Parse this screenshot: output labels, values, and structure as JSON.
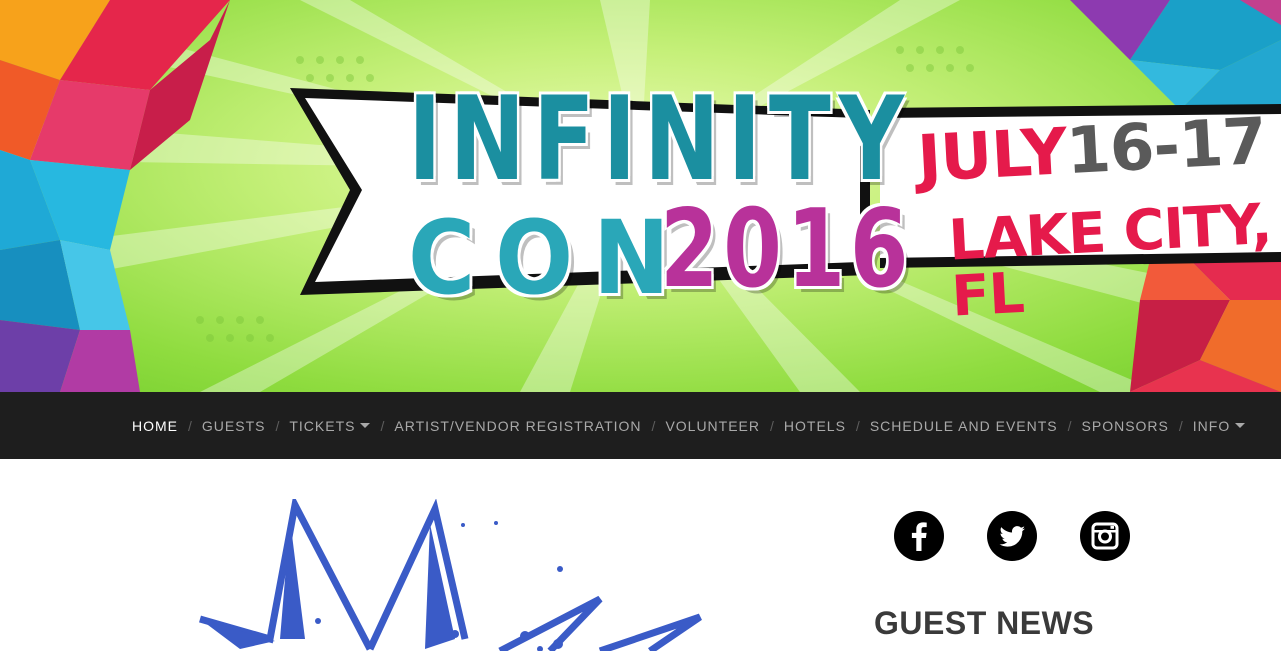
{
  "banner": {
    "title_line1": "INFINITY",
    "title_con": "CON",
    "title_year": "2016",
    "date_month": "JULY",
    "date_days": "16-17",
    "location": "LAKE CITY, FL"
  },
  "nav": {
    "items": [
      {
        "label": "HOME",
        "active": true
      },
      {
        "label": "GUESTS"
      },
      {
        "label": "TICKETS",
        "dropdown": true
      },
      {
        "label": "ARTIST/VENDOR REGISTRATION"
      },
      {
        "label": "VOLUNTEER"
      },
      {
        "label": "HOTELS"
      },
      {
        "label": "SCHEDULE AND EVENTS"
      },
      {
        "label": "SPONSORS"
      },
      {
        "label": "INFO",
        "dropdown": true
      }
    ],
    "separator": "/"
  },
  "social": {
    "icons": [
      "facebook-icon",
      "twitter-icon",
      "instagram-icon"
    ]
  },
  "sidebar": {
    "heading": "GUEST NEWS"
  },
  "colors": {
    "nav_bg": "#1e1e1e",
    "nav_text": "#a9a9a9",
    "nav_active": "#ffffff",
    "title_teal": "#1b8fa0",
    "title_magenta": "#b8329a",
    "date_red": "#e51a4b",
    "burst_blue": "#3a5bc7"
  }
}
